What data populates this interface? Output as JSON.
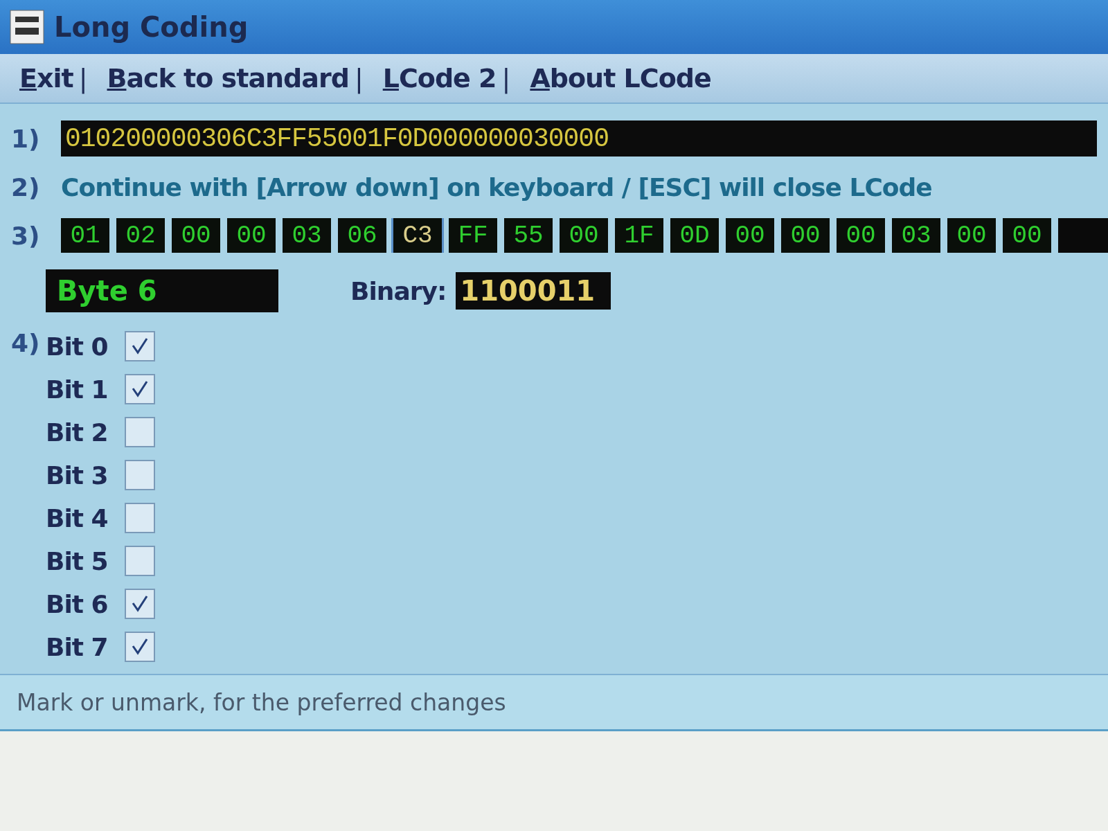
{
  "window": {
    "title": "Long Coding"
  },
  "menu": [
    {
      "label": "Exit",
      "first_letter_underlined": true,
      "separator": "|"
    },
    {
      "label": "Back to standard",
      "first_letter_underlined": true,
      "separator": "|"
    },
    {
      "label": "LCode 2",
      "first_letter_underlined": true,
      "separator": "|"
    },
    {
      "label": "About LCode",
      "first_letter_underlined": true
    }
  ],
  "step1": {
    "number": "1)",
    "value": "010200000306C3FF55001F0D000000030000"
  },
  "step2": {
    "number": "2)",
    "text": "Continue with [Arrow down] on keyboard / [ESC] will close LCode"
  },
  "step3": {
    "number": "3)",
    "bytes": [
      {
        "value": "01",
        "selected": false
      },
      {
        "value": "02",
        "selected": false
      },
      {
        "value": "00",
        "selected": false
      },
      {
        "value": "00",
        "selected": false
      },
      {
        "value": "03",
        "selected": false
      },
      {
        "value": "06",
        "selected": false
      },
      {
        "value": "C3",
        "selected": true
      },
      {
        "value": "FF",
        "selected": false
      },
      {
        "value": "55",
        "selected": false
      },
      {
        "value": "00",
        "selected": false
      },
      {
        "value": "1F",
        "selected": false
      },
      {
        "value": "0D",
        "selected": false
      },
      {
        "value": "00",
        "selected": false
      },
      {
        "value": "00",
        "selected": false
      },
      {
        "value": "00",
        "selected": false
      },
      {
        "value": "03",
        "selected": false
      },
      {
        "value": "00",
        "selected": false
      },
      {
        "value": "00",
        "selected": false
      }
    ],
    "byte_label": "Byte 6",
    "binary_label": "Binary:",
    "binary_value": "1100011"
  },
  "step4": {
    "number": "4)",
    "bits": [
      {
        "label": "Bit 0",
        "checked": true
      },
      {
        "label": "Bit 1",
        "checked": true
      },
      {
        "label": "Bit 2",
        "checked": false
      },
      {
        "label": "Bit 3",
        "checked": false
      },
      {
        "label": "Bit 4",
        "checked": false
      },
      {
        "label": "Bit 5",
        "checked": false
      },
      {
        "label": "Bit 6",
        "checked": true
      },
      {
        "label": "Bit 7",
        "checked": true
      }
    ]
  },
  "status_bar": "Mark or unmark, for the preferred changes"
}
